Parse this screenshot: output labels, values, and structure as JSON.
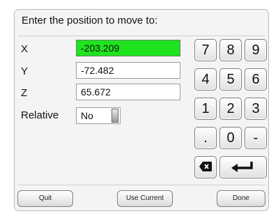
{
  "dialog": {
    "title": "Enter the position to move to:"
  },
  "fields": {
    "x": {
      "label": "X",
      "value": "-203.209"
    },
    "y": {
      "label": "Y",
      "value": "-72.482"
    },
    "z": {
      "label": "Z",
      "value": "65.672"
    },
    "relative": {
      "label": "Relative",
      "value": "No"
    }
  },
  "keypad": {
    "k7": "7",
    "k8": "8",
    "k9": "9",
    "k4": "4",
    "k5": "5",
    "k6": "6",
    "k1": "1",
    "k2": "2",
    "k3": "3",
    "dot": ".",
    "k0": "0",
    "minus": "-",
    "backspace_icon": "backspace-icon",
    "enter_icon": "enter-icon"
  },
  "buttons": {
    "quit": "Quit",
    "use_current": "Use Current",
    "done": "Done"
  },
  "colors": {
    "active_field": "#1ee31e"
  }
}
